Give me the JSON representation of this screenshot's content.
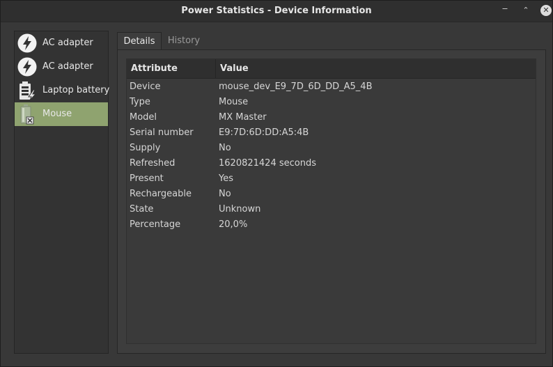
{
  "window": {
    "title": "Power Statistics - Device Information",
    "controls": {
      "minimize": "‒",
      "maximize": "⌃",
      "close": "✕"
    }
  },
  "sidebar": {
    "items": [
      {
        "label": "AC adapter",
        "icon": "ac-adapter-icon",
        "selected": false
      },
      {
        "label": "AC adapter",
        "icon": "ac-adapter-icon",
        "selected": false
      },
      {
        "label": "Laptop battery",
        "icon": "battery-icon",
        "selected": false
      },
      {
        "label": "Mouse",
        "icon": "mouse-battery-icon",
        "selected": true
      }
    ]
  },
  "tabs": [
    {
      "label": "Details",
      "active": true
    },
    {
      "label": "History",
      "active": false
    }
  ],
  "details": {
    "headers": {
      "attribute": "Attribute",
      "value": "Value"
    },
    "rows": [
      {
        "attribute": "Device",
        "value": "mouse_dev_E9_7D_6D_DD_A5_4B"
      },
      {
        "attribute": "Type",
        "value": "Mouse"
      },
      {
        "attribute": "Model",
        "value": "MX Master"
      },
      {
        "attribute": "Serial number",
        "value": "E9:7D:6D:DD:A5:4B"
      },
      {
        "attribute": "Supply",
        "value": "No"
      },
      {
        "attribute": "Refreshed",
        "value": "1620821424 seconds"
      },
      {
        "attribute": "Present",
        "value": "Yes"
      },
      {
        "attribute": "Rechargeable",
        "value": "No"
      },
      {
        "attribute": "State",
        "value": "Unknown"
      },
      {
        "attribute": "Percentage",
        "value": "20,0%"
      }
    ]
  },
  "colors": {
    "selection": "#8fa36f",
    "background": "#383838"
  }
}
